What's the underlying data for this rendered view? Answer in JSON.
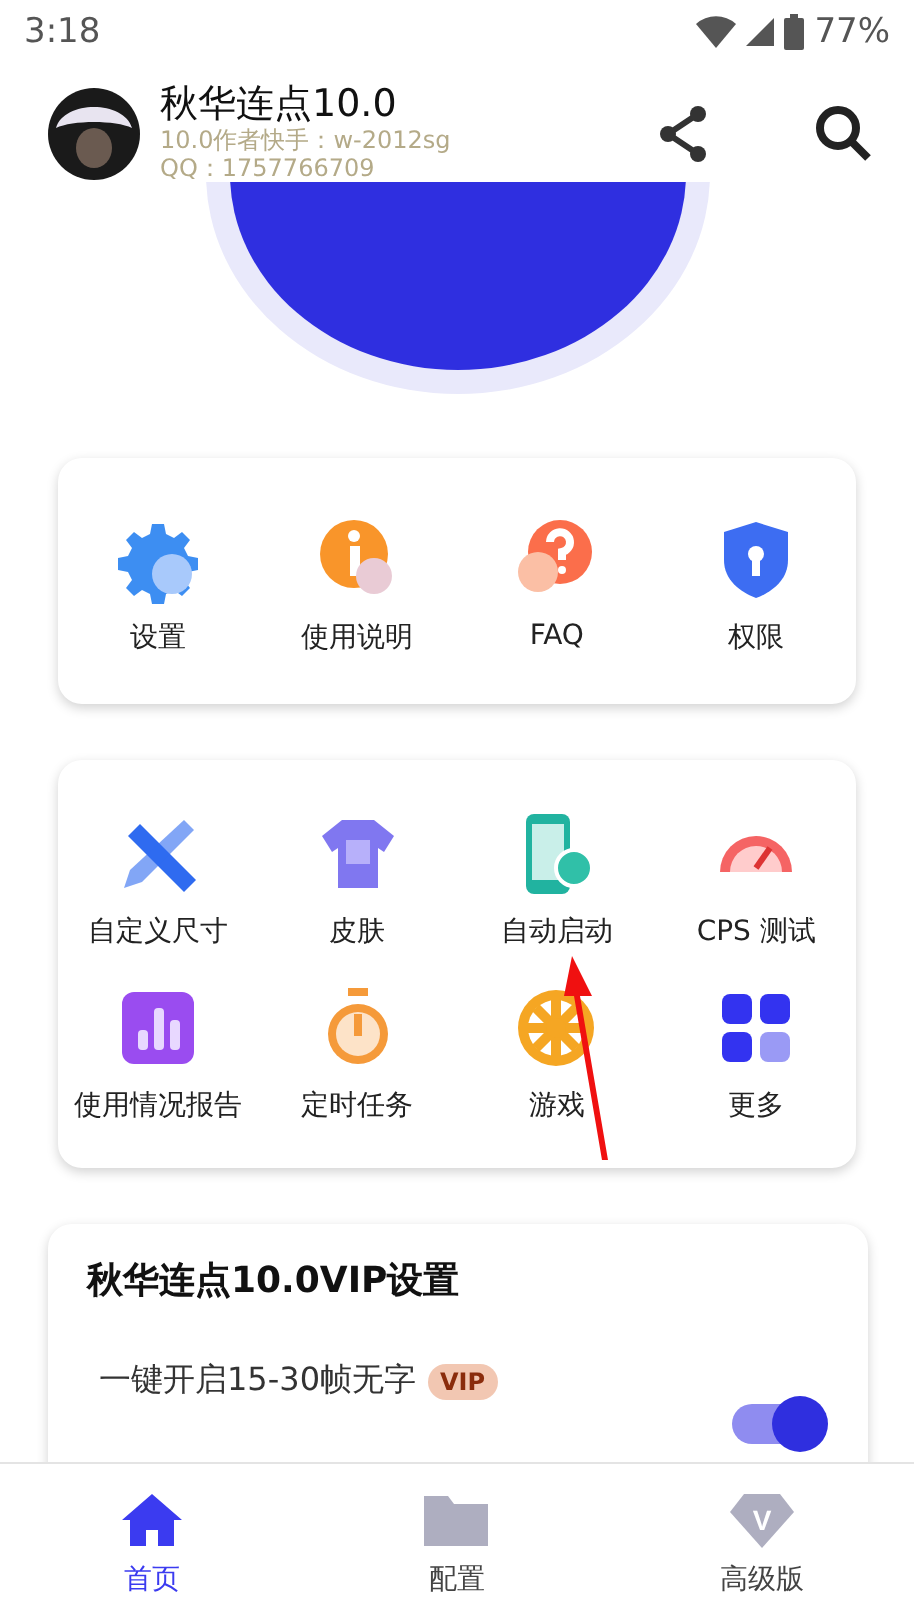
{
  "status_bar": {
    "time": "3:18",
    "battery": "77%"
  },
  "header": {
    "title": "秋华连点10.0",
    "subtitle": "10.0作者快手：w-2012sg",
    "qq": "QQ：1757766709"
  },
  "quick_actions": [
    {
      "label": "设置"
    },
    {
      "label": "使用说明"
    },
    {
      "label": "FAQ"
    },
    {
      "label": "权限"
    }
  ],
  "tools": [
    {
      "label": "自定义尺寸"
    },
    {
      "label": "皮肤"
    },
    {
      "label": "自动启动"
    },
    {
      "label": "CPS 测试"
    },
    {
      "label": "使用情况报告"
    },
    {
      "label": "定时任务"
    },
    {
      "label": "游戏"
    },
    {
      "label": "更多"
    }
  ],
  "vip_card": {
    "title": "秋华连点10.0VIP设置",
    "rows": [
      {
        "label": "一键开启15-30帧无字",
        "badge": "VIP",
        "on": true
      }
    ]
  },
  "bottom_nav": [
    {
      "label": "首页",
      "selected": true
    },
    {
      "label": "配置",
      "selected": false
    },
    {
      "label": "高级版",
      "icon_letter": "V",
      "selected": false
    }
  ]
}
